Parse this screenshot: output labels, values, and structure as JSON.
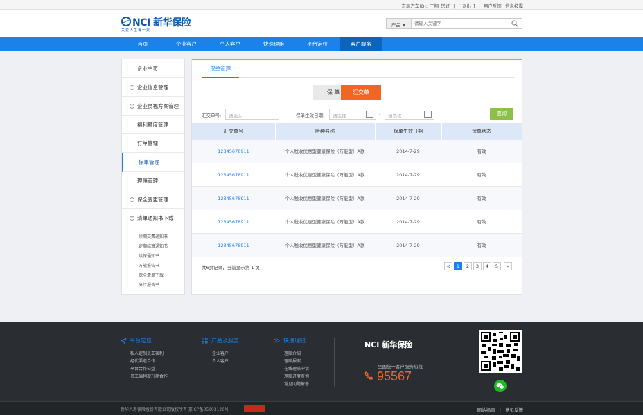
{
  "topbar": {
    "company": "东风汽车(B):",
    "user": "王翔",
    "greeting": "您好",
    "logout": "退出",
    "feedback": "用户反馈",
    "feedback2": "信息披露"
  },
  "header": {
    "logo_text": "NCI 新华保险",
    "slogan": "关爱人生每一天",
    "search": {
      "category": "产品",
      "placeholder": "请输入关键字"
    }
  },
  "nav": {
    "items": [
      {
        "label": "首页"
      },
      {
        "label": "企业客户"
      },
      {
        "label": "个人客户"
      },
      {
        "label": "快速理赔"
      },
      {
        "label": "平台定位"
      },
      {
        "label": "客户服务"
      }
    ],
    "active_index": 5
  },
  "sidebar": {
    "items": [
      {
        "label": "企业主页",
        "expandable": false
      },
      {
        "label": "企业信息管理",
        "expandable": true
      },
      {
        "label": "企业员福方案管理",
        "expandable": true
      },
      {
        "label": "福利额度管理",
        "expandable": false
      },
      {
        "label": "订单管理",
        "expandable": false
      },
      {
        "label": "保单管理",
        "expandable": false
      },
      {
        "label": "理赔管理",
        "expandable": false
      },
      {
        "label": "保全变更管理",
        "expandable": true
      },
      {
        "label": "清单通知书下载",
        "expandable": true
      }
    ],
    "active_index": 5,
    "subitems": [
      "续期交费通知书",
      "定期结算通知书",
      "续保通知书",
      "万能报告书",
      "保全清单下载",
      "分红报告书"
    ]
  },
  "main": {
    "tab": "保单管理",
    "toggle": {
      "policy": "保 单",
      "summary": "汇交单",
      "active": "summary"
    },
    "filter": {
      "summary_no_label": "汇交单号:",
      "summary_no_placeholder": "请输入",
      "date_label": "保单生效日期:",
      "date_from_placeholder": "请选择",
      "date_sep": "-",
      "date_to_placeholder": "请选择",
      "query": "查询"
    },
    "table": {
      "columns": [
        "汇交单号",
        "险种名称",
        "保单生效日期",
        "保单状态"
      ],
      "rows": [
        [
          "12345678911",
          "个人税收优惠型健康保险（万能型）A款",
          "2014-7-29",
          "有效"
        ],
        [
          "12345678911",
          "个人税收优惠型健康保险（万能型）A款",
          "2014-7-29",
          "有效"
        ],
        [
          "12345678911",
          "个人税收优惠型健康保险（万能型）A款",
          "2014-7-29",
          "有效"
        ],
        [
          "12345678911",
          "个人税收优惠型健康保险（万能型）A款",
          "2014-7-29",
          "有效"
        ],
        [
          "12345678911",
          "个人税收优惠型健康保险（万能型）A款",
          "2014-7-29",
          "有效"
        ]
      ]
    },
    "summary_text": "共6页记录，当前显示第 1 页",
    "pager": {
      "prev": "<",
      "pages": [
        "1",
        "2",
        "3",
        "4",
        "5"
      ],
      "next": ">",
      "current": "1"
    }
  },
  "footer": {
    "cols": [
      {
        "title": "平台定位",
        "links": [
          "私人定制员工福利",
          "经代渠道合作",
          "平台合作公益",
          "员工福利提升商合作"
        ]
      },
      {
        "title": "产品及服务",
        "links": [
          "企业客户",
          "个人客户"
        ]
      },
      {
        "title": "快速理赔",
        "links": [
          "理赔介绍",
          "理赔报案",
          "在线理赔申请",
          "理赔进度查询",
          "常见问题解答"
        ]
      }
    ],
    "logo_text": "NCI 新华保险",
    "hotline_label": "全国统一客户服务热线",
    "hotline": "95567",
    "copyright": "新华人寿保险股份有限公司版权所有 京ICP备05003120号",
    "links": [
      "网站指南",
      "|",
      "意见反馈"
    ]
  },
  "colors": {
    "brand_blue": "#1a82e8",
    "nav_active": "#0d64bf",
    "accent_orange": "#f26522",
    "query_green": "#8cc04a",
    "footer_bg": "#2a2d31"
  }
}
